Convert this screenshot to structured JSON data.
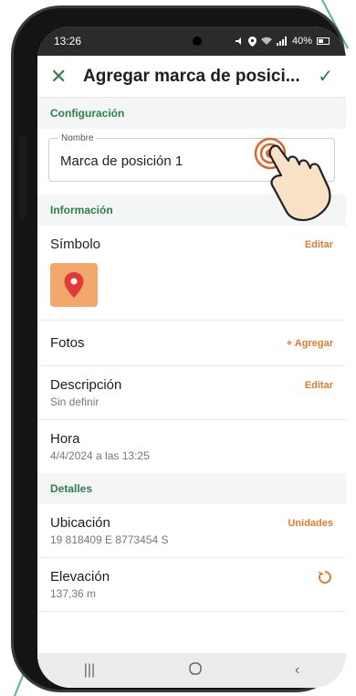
{
  "status_bar": {
    "time": "13:26",
    "battery": "40%"
  },
  "app_bar": {
    "title": "Agregar marca de posici..."
  },
  "sections": {
    "configuracion": "Configuración",
    "informacion": "Información",
    "detalles": "Detalles"
  },
  "name_field": {
    "label": "Nombre",
    "value": "Marca de posición 1"
  },
  "rows": {
    "simbolo": {
      "label": "Símbolo",
      "action": "Editar"
    },
    "fotos": {
      "label": "Fotos",
      "action": "+ Agregar"
    },
    "descripcion": {
      "label": "Descripción",
      "value": "Sin definir",
      "action": "Editar"
    },
    "hora": {
      "label": "Hora",
      "value": "4/4/2024 a las 13:25"
    },
    "ubicacion": {
      "label": "Ubicación",
      "value": "19 818409 E 8773454 S",
      "action": "Unidades"
    },
    "elevacion": {
      "label": "Elevación",
      "value": "137,36 m"
    }
  },
  "colors": {
    "accent_green": "#2e7d4f",
    "accent_orange": "#e07a2e",
    "symbol_bg": "#f2a86a",
    "pin_red": "#e23a3a"
  },
  "icons": [
    "close-icon",
    "check-icon",
    "location-pin-icon",
    "reset-icon",
    "recent-apps-icon",
    "home-icon",
    "back-icon",
    "tap-hand-icon"
  ]
}
